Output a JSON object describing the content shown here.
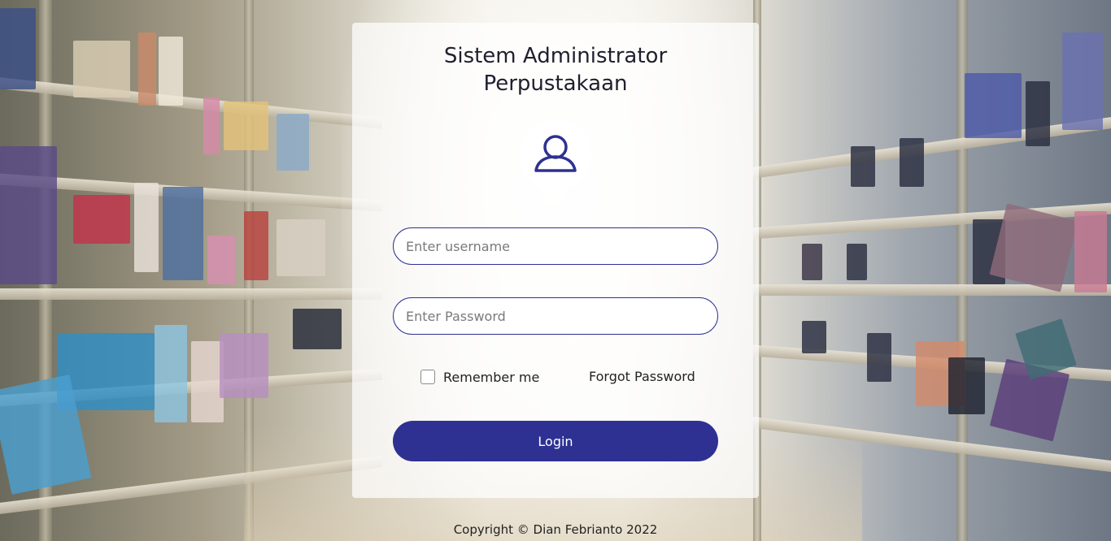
{
  "login": {
    "title_line1": "Sistem Administrator",
    "title_line2": "Perpustakaan",
    "avatar_icon": "user-icon",
    "username_placeholder": "Enter username",
    "password_placeholder": "Enter Password",
    "remember_label": "Remember me",
    "forgot_label": "Forgot Password",
    "login_label": "Login"
  },
  "footer": {
    "copyright": "Copyright © Dian Febrianto 2022"
  },
  "background": {
    "description_icon": "library-bookshelves-image"
  },
  "colors": {
    "accent": "#2e3192",
    "card": "#ffffff"
  }
}
